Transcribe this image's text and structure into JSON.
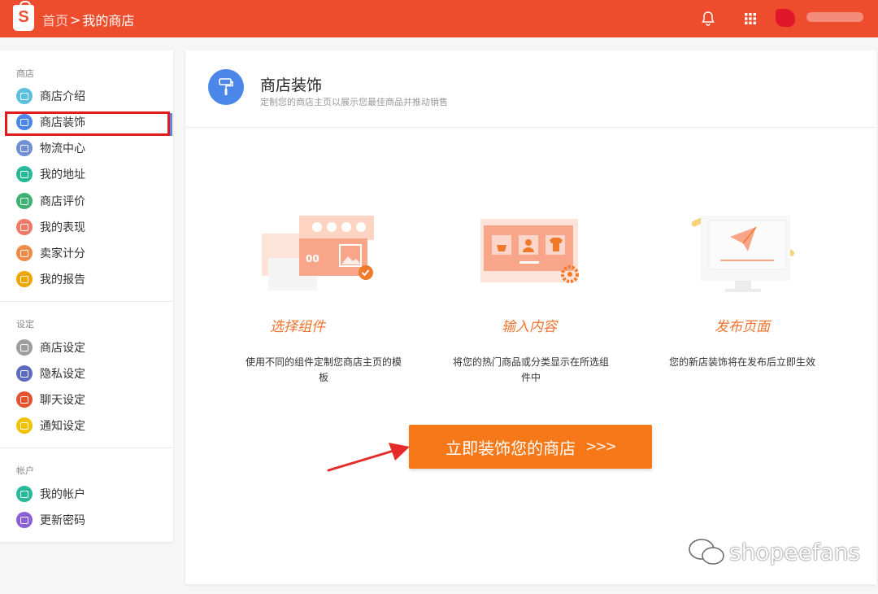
{
  "header": {
    "logo_letter": "S",
    "breadcrumb_home": "首页",
    "breadcrumb_sep": ">",
    "breadcrumb_current": "我的商店",
    "bell_icon": "bell-icon",
    "apps_icon": "grid-icon"
  },
  "sidebar": {
    "groups": [
      {
        "label": "商店",
        "items": [
          {
            "label": "商店介绍",
            "icon": "mail-icon",
            "color": "#5bc0de"
          },
          {
            "label": "商店装饰",
            "icon": "brush-icon",
            "color": "#4a87e8"
          },
          {
            "label": "物流中心",
            "icon": "truck-icon",
            "color": "#6f8fd6"
          },
          {
            "label": "我的地址",
            "icon": "location-icon",
            "color": "#26b99a"
          },
          {
            "label": "商店评价",
            "icon": "star-icon",
            "color": "#3cb371"
          },
          {
            "label": "我的表现",
            "icon": "chart-icon",
            "color": "#f07a65"
          },
          {
            "label": "卖家计分",
            "icon": "bolt-icon",
            "color": "#f08a45"
          },
          {
            "label": "我的报告",
            "icon": "report-icon",
            "color": "#f0a500"
          }
        ]
      },
      {
        "label": "设定",
        "items": [
          {
            "label": "商店设定",
            "icon": "gear-icon",
            "color": "#9e9e9e"
          },
          {
            "label": "隐私设定",
            "icon": "lock-icon",
            "color": "#5c6bc0"
          },
          {
            "label": "聊天设定",
            "icon": "chat-icon",
            "color": "#e5522d"
          },
          {
            "label": "通知设定",
            "icon": "notification-icon",
            "color": "#f2c200"
          }
        ]
      },
      {
        "label": "帐户",
        "items": [
          {
            "label": "我的帐户",
            "icon": "id-card-icon",
            "color": "#26b99a"
          },
          {
            "label": "更新密码",
            "icon": "key-icon",
            "color": "#8a5fd8"
          }
        ]
      }
    ]
  },
  "main": {
    "title": "商店装饰",
    "subtitle": "定制您的商店主页以展示您最佳商品并推动销售",
    "steps": [
      {
        "title": "选择组件",
        "description": "使用不同的组件定制您商店主页的模板",
        "illus_text": "00"
      },
      {
        "title": "输入内容",
        "description": "将您的热门商品或分类显示在所选组件中"
      },
      {
        "title": "发布页面",
        "description": "您的新店装饰将在发布后立即生效"
      }
    ],
    "cta_label": "立即装饰您的商店",
    "cta_chevrons": ">>>"
  },
  "watermark": "shopeefans",
  "colors": {
    "brand": "#ee4d2d",
    "cta": "#f67818",
    "accent_blue": "#4a87e8",
    "step_title": "#f0732e",
    "highlight_box": "#e21b1b"
  }
}
